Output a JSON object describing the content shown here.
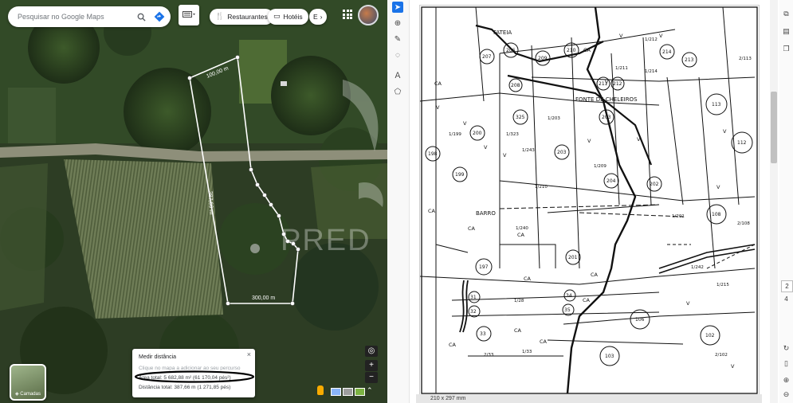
{
  "maps": {
    "search": {
      "placeholder": "Pesquisar no Google Maps"
    },
    "chips": {
      "restaurants": "Restaurantes",
      "hotels": "Hotéis",
      "more": "E"
    },
    "map_labels": {
      "top_edge": "100,00 m",
      "west_edge": "387,66 m",
      "south_edge": "300,00 m",
      "watermark": "PRED"
    },
    "layers_label": "Camadas",
    "measure": {
      "title": "Medir distância",
      "hint": "Clique no mapa a adicionar ao seu percurso",
      "area": "Área total: 5 682,88 m² (61 170,04 pés²)",
      "distance": "Distância total: 387,66 m (1 271,85 pés)"
    }
  },
  "viewer": {
    "page_size": "210 x 297 mm",
    "page_current": "2",
    "page_total": "4",
    "map": {
      "place_names": [
        "FATEIA",
        "FONTE DE CHELEIROS",
        "BARRO"
      ],
      "parcels": [
        "207",
        "206",
        "209",
        "210",
        "211",
        "212",
        "214",
        "213",
        "113",
        "208",
        "325",
        "203",
        "200",
        "263",
        "198",
        "199",
        "203",
        "204",
        "202",
        "112",
        "108",
        "197",
        "201",
        "31",
        "32",
        "33",
        "34",
        "35",
        "106",
        "103",
        "102"
      ],
      "fractions": [
        "1/199",
        "1/203",
        "1/323",
        "1/243",
        "1/210",
        "1/240",
        "1/209",
        "1/201",
        "1/242",
        "2/108",
        "1/28",
        "1/33",
        "2/33",
        "2/102",
        "2/113",
        "1/211",
        "1/212",
        "1/214",
        "1/215"
      ],
      "use_codes": [
        "CA",
        "V"
      ]
    }
  },
  "colors": {
    "measure_line": "#ffffff",
    "tool_selected": "#1a73e8",
    "map_ink": "#111111"
  }
}
